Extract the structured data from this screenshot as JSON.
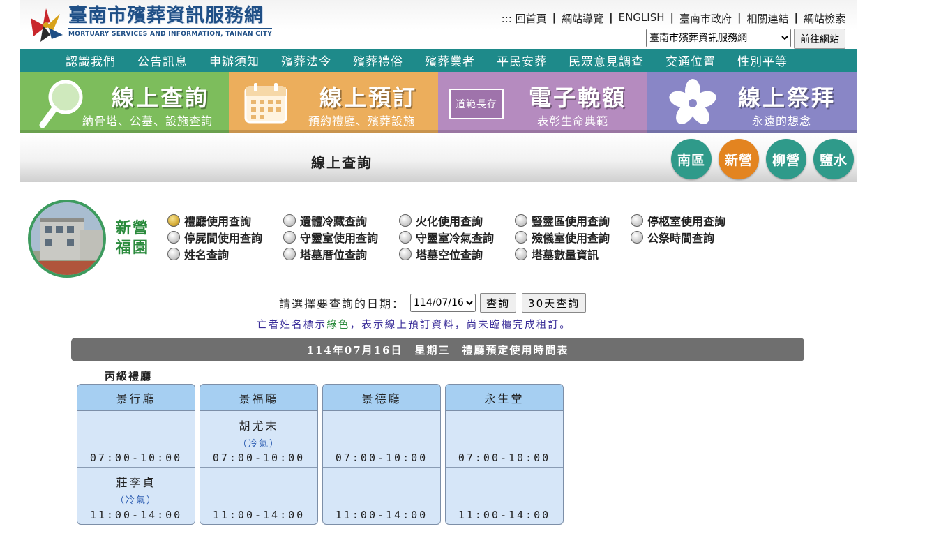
{
  "header": {
    "logo_title": "臺南市殯葬資訊服務網",
    "logo_subtitle": "MORTUARY SERVICES AND INFORMATION, TAINAN CITY",
    "top_links": [
      {
        "label": "::: 回首頁"
      },
      {
        "label": "網站導覽"
      },
      {
        "label": "ENGLISH"
      },
      {
        "label": "臺南市政府"
      },
      {
        "label": "相關連結"
      },
      {
        "label": "網站檢索"
      }
    ],
    "site_select_value": "臺南市殯葬資訊服務網",
    "go_button": "前往網站"
  },
  "nav": [
    {
      "label": "認識我們"
    },
    {
      "label": "公告訊息"
    },
    {
      "label": "申辦須知"
    },
    {
      "label": "殯葬法令"
    },
    {
      "label": "殯葬禮俗"
    },
    {
      "label": "殯葬業者"
    },
    {
      "label": "平民安葬"
    },
    {
      "label": "民眾意見調查"
    },
    {
      "label": "交通位置"
    },
    {
      "label": "性別平等"
    }
  ],
  "tiles": [
    {
      "title": "線上查詢",
      "subtitle": "納骨塔、公墓、設施查詢",
      "icon": "magnifier-icon",
      "color": "#7dbd5c"
    },
    {
      "title": "線上預訂",
      "subtitle": "預約禮廳、殯葬設施",
      "icon": "calendar-icon",
      "color": "#ecae5c"
    },
    {
      "title": "電子輓額",
      "subtitle": "表彰生命典範",
      "icon": "plaque-icon",
      "plaque_text": "道範長存",
      "color": "#b58bbf"
    },
    {
      "title": "線上祭拜",
      "subtitle": "永遠的想念",
      "icon": "flower-icon",
      "color": "#8986c6"
    }
  ],
  "page_title": "線上查詢",
  "regions": [
    {
      "label": "南區",
      "active": false
    },
    {
      "label": "新營",
      "active": true
    },
    {
      "label": "柳營",
      "active": false
    },
    {
      "label": "鹽水",
      "active": false
    }
  ],
  "facility": {
    "name_line1": "新營",
    "name_line2": "福園"
  },
  "query_options": [
    {
      "label": "禮廳使用查詢",
      "selected": true
    },
    {
      "label": "遺體冷藏查詢",
      "selected": false
    },
    {
      "label": "火化使用查詢",
      "selected": false
    },
    {
      "label": "豎靈區使用查詢",
      "selected": false
    },
    {
      "label": "停柩室使用查詢",
      "selected": false
    },
    {
      "label": "停屍間使用查詢",
      "selected": false
    },
    {
      "label": "守靈室使用查詢",
      "selected": false
    },
    {
      "label": "守靈室冷氣查詢",
      "selected": false
    },
    {
      "label": "殮儀室使用查詢",
      "selected": false
    },
    {
      "label": "公祭時間查詢",
      "selected": false
    },
    {
      "label": "姓名查詢",
      "selected": false
    },
    {
      "label": "塔墓厝位查詢",
      "selected": false
    },
    {
      "label": "塔墓空位查詢",
      "selected": false
    },
    {
      "label": "塔墓數量資訊",
      "selected": false
    }
  ],
  "date_query": {
    "label": "請選擇要查詢的日期：",
    "date_value": "114/07/16",
    "query_button": "查詢",
    "query30_button": "30天查詢"
  },
  "notice": {
    "before": "亡者姓名標示",
    "green": "綠色",
    "after": "，表示線上預訂資料，尚未臨櫃完成租訂。"
  },
  "schedule_title": "114年07月16日　星期三　禮廳預定使用時間表",
  "grade_label": "丙級禮廳",
  "halls": [
    {
      "name": "景行廳",
      "slots": [
        {
          "person": "",
          "aircon": "",
          "time": "07:00-10:00"
        },
        {
          "person": "莊李貞",
          "aircon": "（冷氣）",
          "time": "11:00-14:00"
        }
      ]
    },
    {
      "name": "景福廳",
      "slots": [
        {
          "person": "胡尤末",
          "aircon": "（冷氣）",
          "time": "07:00-10:00"
        },
        {
          "person": "",
          "aircon": "",
          "time": "11:00-14:00"
        }
      ]
    },
    {
      "name": "景德廳",
      "slots": [
        {
          "person": "",
          "aircon": "",
          "time": "07:00-10:00"
        },
        {
          "person": "",
          "aircon": "",
          "time": "11:00-14:00"
        }
      ]
    },
    {
      "name": "永生堂",
      "slots": [
        {
          "person": "",
          "aircon": "",
          "time": "07:00-10:00"
        },
        {
          "person": "",
          "aircon": "",
          "time": "11:00-14:00"
        }
      ]
    }
  ]
}
